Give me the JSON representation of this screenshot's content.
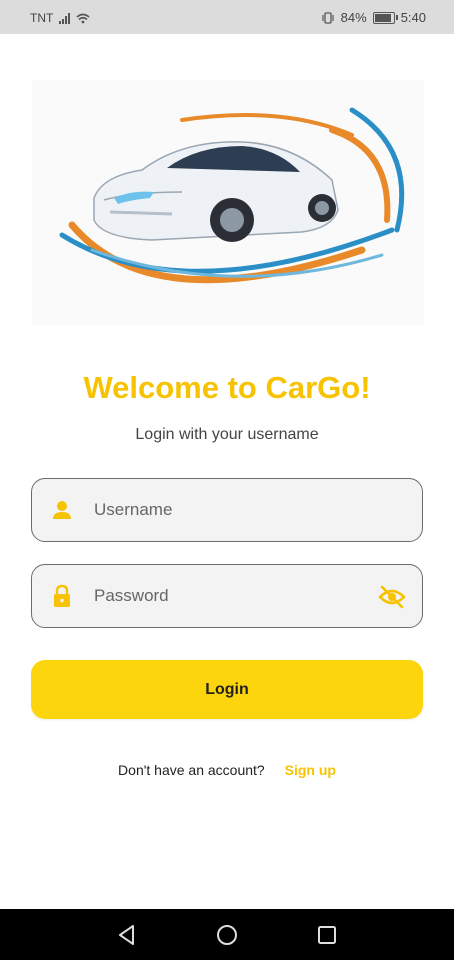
{
  "status_bar": {
    "carrier": "TNT",
    "battery": "84%",
    "battery_level": 0.84,
    "time": "5:40"
  },
  "hero": {
    "image_icon": "car-illustration"
  },
  "header": {
    "title": "Welcome to CarGo!",
    "subtitle": "Login with your username"
  },
  "form": {
    "username": {
      "placeholder": "Username",
      "value": "",
      "icon": "person-icon"
    },
    "password": {
      "placeholder": "Password",
      "value": "",
      "icon": "lock-icon",
      "toggle_icon": "eye-off-icon"
    },
    "login_label": "Login"
  },
  "signup": {
    "question": "Don't have an account?",
    "link_label": "Sign up"
  },
  "colors": {
    "accent": "#fcd50d",
    "title": "#f7c300",
    "field_bg": "#f3f3f3"
  }
}
